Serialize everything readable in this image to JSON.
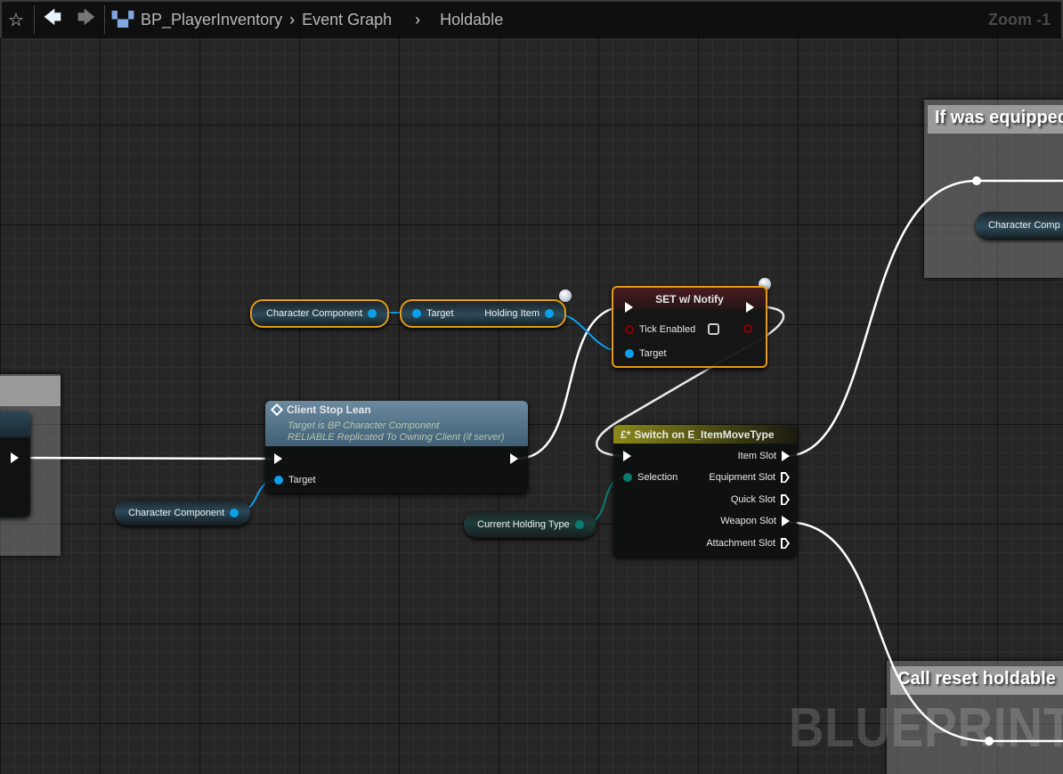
{
  "breadcrumb": {
    "asset": "BP_PlayerInventory",
    "graph": "Event Graph",
    "collapsed": "Holdable"
  },
  "zoom_label": "Zoom -1",
  "watermark": "BLUEPRINT",
  "comments": [
    {
      "title": "If was equipped"
    },
    {
      "title": "Call reset holdable"
    }
  ],
  "nodes": {
    "var_character_component_1": {
      "label": "Character Component"
    },
    "get_holding_item": {
      "target": "Target",
      "output": "Holding Item"
    },
    "set_notify": {
      "title": "SET w/ Notify",
      "tick": "Tick Enabled",
      "target": "Target",
      "checked": false
    },
    "client_stop_lean": {
      "title": "Client Stop Lean",
      "sub1": "Target is BP Character Component",
      "sub2": "RELIABLE Replicated To Owning Client (if server)",
      "target": "Target"
    },
    "var_character_component_2": {
      "label": "Character Component"
    },
    "var_current_holding_type": {
      "label": "Current Holding Type"
    },
    "switch": {
      "title": "Switch on E_ItemMoveType",
      "selection": "Selection",
      "outputs": [
        "Item Slot",
        "Equipment Slot",
        "Quick Slot",
        "Weapon Slot",
        "Attachment Slot"
      ]
    },
    "var_character_component_3": {
      "label": "Character Comp"
    }
  },
  "colors": {
    "object_pin": "#0aa0ea",
    "enum_pin": "#0b7a72",
    "selected": "#e59a13",
    "bool_pin": "#8b0000",
    "switch_header": "#8a8a1a"
  }
}
